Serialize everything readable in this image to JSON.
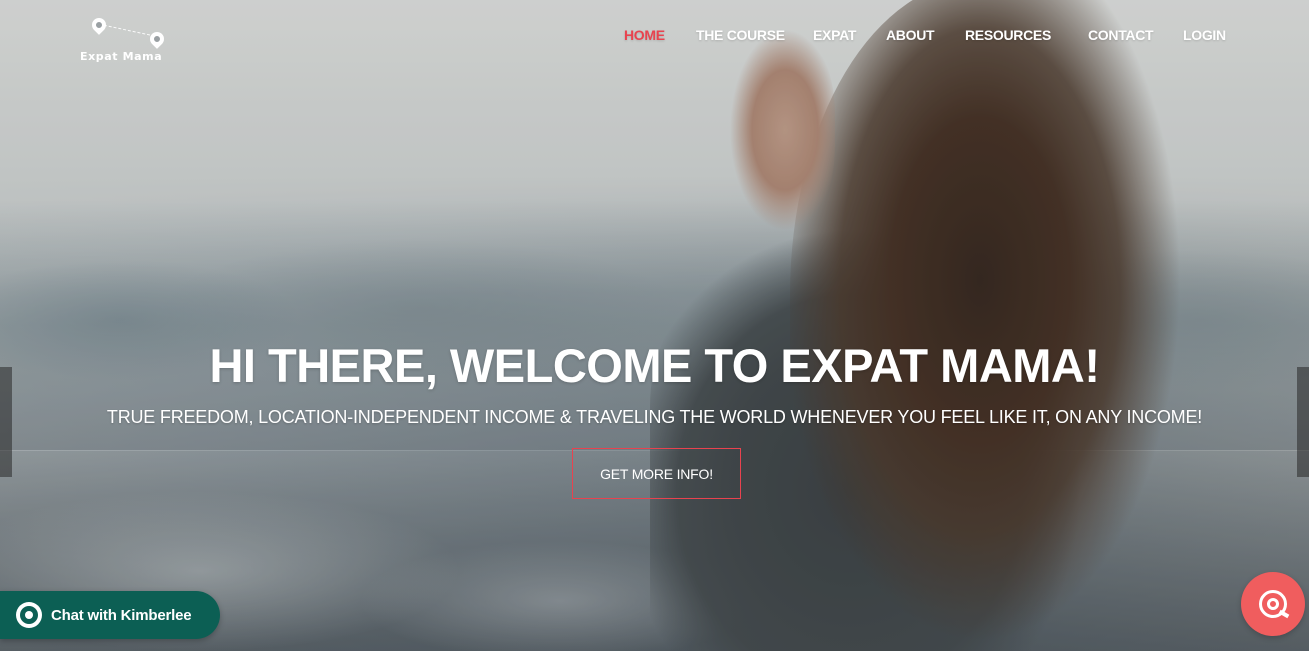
{
  "logo": {
    "text": "Expat Mama"
  },
  "nav": {
    "items": [
      {
        "label": "HOME",
        "active": true
      },
      {
        "label": "THE COURSE",
        "active": false
      },
      {
        "label": "EXPAT",
        "active": false
      },
      {
        "label": "ABOUT",
        "active": false
      },
      {
        "label": "RESOURCES",
        "active": false
      },
      {
        "label": "CONTACT",
        "active": false
      },
      {
        "label": "LOGIN",
        "active": false
      }
    ]
  },
  "hero": {
    "title": "HI THERE, WELCOME TO EXPAT MAMA!",
    "subtitle": "TRUE FREEDOM, LOCATION-INDEPENDENT INCOME & TRAVELING THE WORLD WHENEVER YOU FEEL LIKE IT, ON ANY INCOME!",
    "cta_label": "GET MORE INFO!"
  },
  "chat": {
    "label": "Chat with Kimberlee",
    "icon": "whatsapp-icon"
  },
  "support": {
    "icon": "support-bubble-icon"
  },
  "colors": {
    "accent": "#e8434f",
    "chat_bg": "#0c5f54",
    "support_bg": "#f05d5e"
  }
}
